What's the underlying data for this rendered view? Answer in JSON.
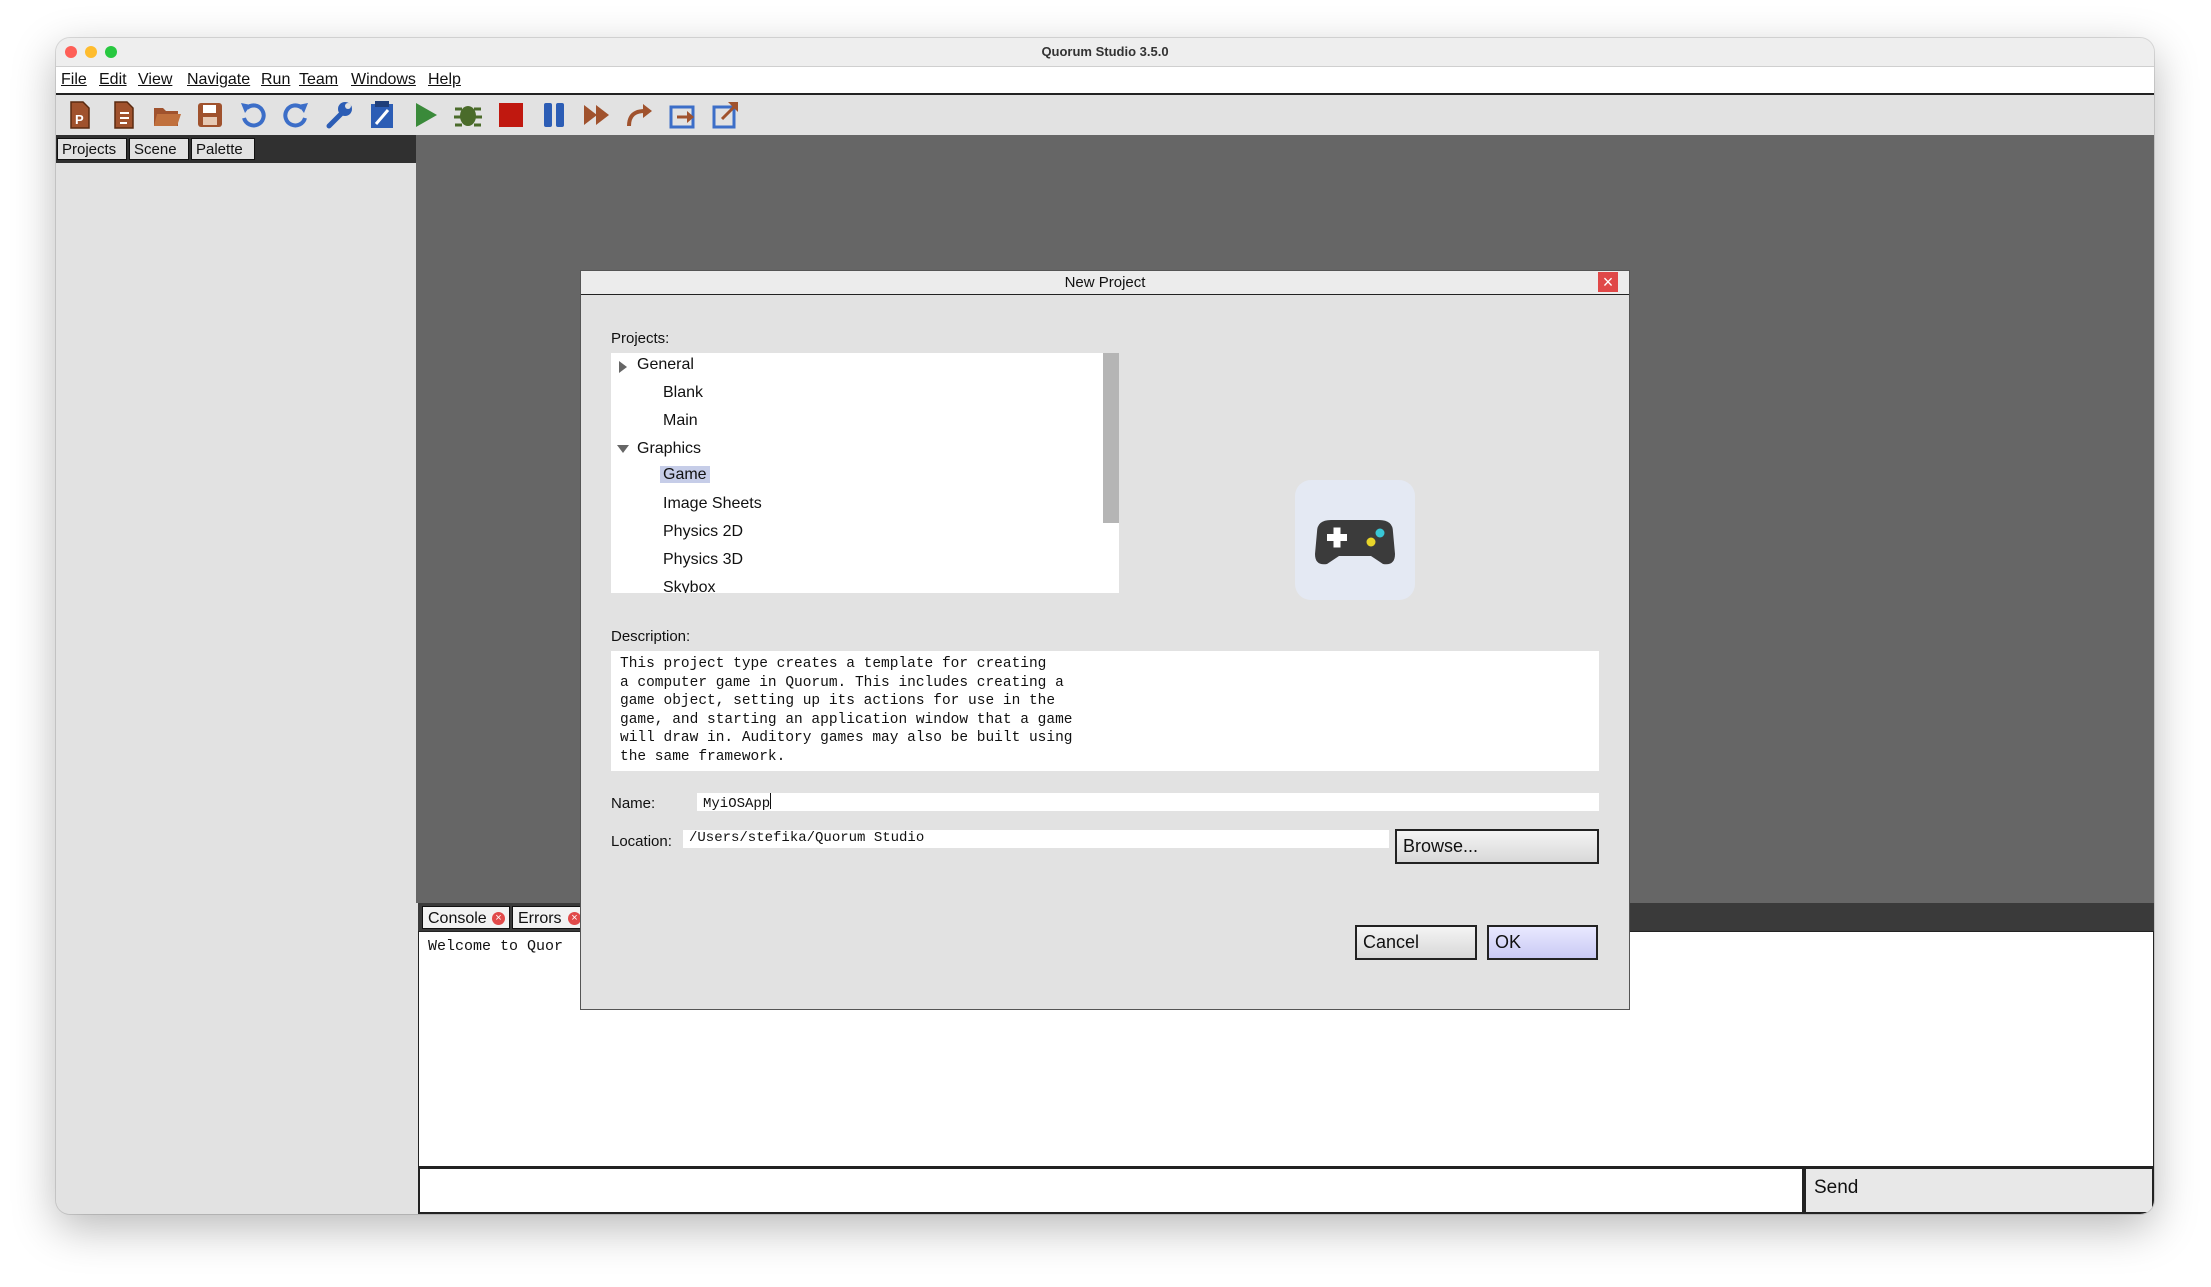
{
  "window": {
    "title": "Quorum Studio 3.5.0"
  },
  "menu": [
    "File",
    "Edit",
    "View",
    "Navigate",
    "Run",
    "Team",
    "Windows",
    "Help"
  ],
  "toolbar": {
    "icons": [
      "new-project-icon",
      "new-file-icon",
      "open-folder-icon",
      "save-icon",
      "undo-icon",
      "redo-icon",
      "wrench-icon",
      "clean-build-icon",
      "run-icon",
      "debug-icon",
      "stop-icon",
      "pause-icon",
      "continue-icon",
      "step-over-icon",
      "step-into-icon",
      "step-out-icon"
    ]
  },
  "left_tabs": [
    "Projects",
    "Scene",
    "Palette"
  ],
  "bottom_tabs": [
    "Console",
    "Errors"
  ],
  "console": {
    "text": "Welcome to Quor"
  },
  "command": {
    "send_label": "Send"
  },
  "colors": {
    "editor_bg": "#666666",
    "selection": "#c6cde8",
    "run_green": "#3a8a3a",
    "stop_red": "#c0180f",
    "toolbar_blue": "#3c6ec8"
  },
  "dialog": {
    "title": "New Project",
    "projects_label": "Projects:",
    "tree": [
      {
        "label": "General",
        "level": 0,
        "expanded": false
      },
      {
        "label": "Blank",
        "level": 1
      },
      {
        "label": "Main",
        "level": 1
      },
      {
        "label": "Graphics",
        "level": 0,
        "expanded": true
      },
      {
        "label": "Game",
        "level": 1,
        "selected": true
      },
      {
        "label": "Image Sheets",
        "level": 1
      },
      {
        "label": "Physics 2D",
        "level": 1
      },
      {
        "label": "Physics 3D",
        "level": 1
      },
      {
        "label": "Skybox",
        "level": 1
      }
    ],
    "preview_icon": "gamepad-icon",
    "description_label": "Description:",
    "description": "This project type creates a template for creating\na computer game in Quorum. This includes creating a\ngame object, setting up its actions for use in the\ngame, and starting an application window that a game\nwill draw in. Auditory games may also be built using\nthe same framework.",
    "name_label": "Name:",
    "name_value": "MyiOSApp",
    "location_label": "Location:",
    "location_value": "/Users/stefika/Quorum Studio",
    "browse_label": "Browse...",
    "cancel_label": "Cancel",
    "ok_label": "OK"
  }
}
